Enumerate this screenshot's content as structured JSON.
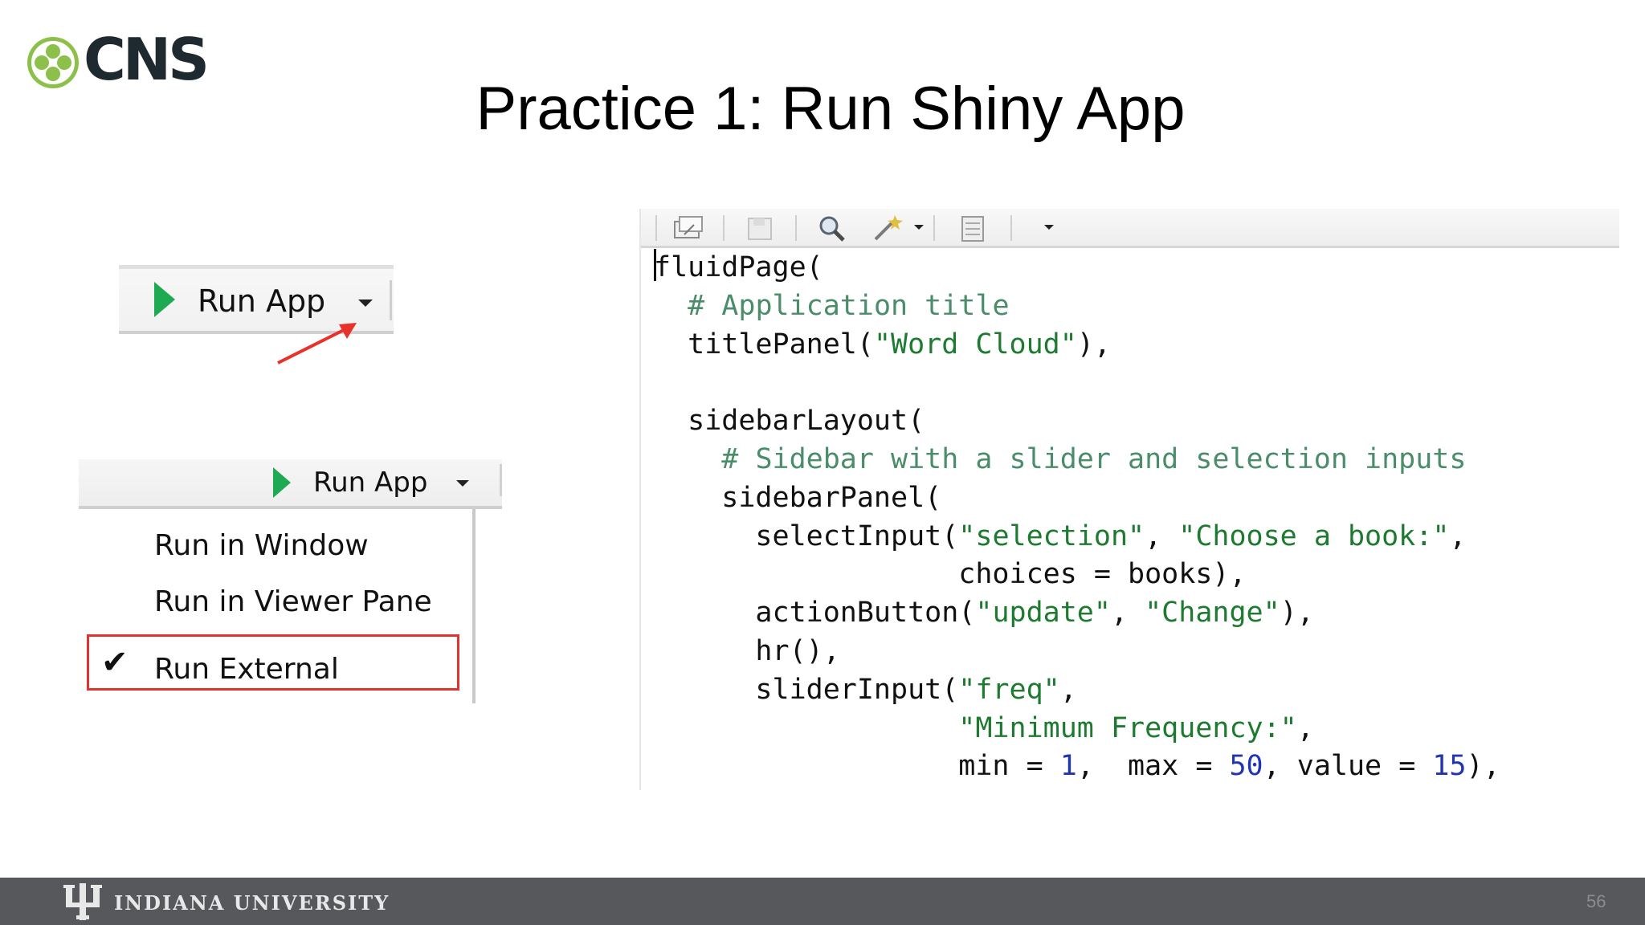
{
  "logo": {
    "text": "CNS",
    "icon": "cns-flower-logo-icon",
    "color": "#8cc04b"
  },
  "slide": {
    "title": "Practice 1: Run Shiny App",
    "page_number": "56"
  },
  "toolbar_top": {
    "run_label": "Run App",
    "play_icon": "play-icon",
    "dropdown_icon": "caret-down-icon"
  },
  "toolbar_menu": {
    "run_label": "Run App"
  },
  "menu": {
    "items": [
      "Run in Window",
      "Run in Viewer Pane",
      "Run External"
    ],
    "checked": "Run External",
    "highlight_color": "#e0322f"
  },
  "editor": {
    "toolbar_icons": [
      "show-in-window-icon",
      "save-icon",
      "search-icon",
      "magic-wand-icon",
      "caret-down-icon",
      "notebook-icon",
      "caret-down-icon"
    ],
    "code_lines": [
      "fluidPage(",
      "  # Application title",
      "  titlePanel(\"Word Cloud\"),",
      "",
      "  sidebarLayout(",
      "    # Sidebar with a slider and selection inputs",
      "    sidebarPanel(",
      "      selectInput(\"selection\", \"Choose a book:\",",
      "                  choices = books),",
      "      actionButton(\"update\", \"Change\"),",
      "      hr(),",
      "      sliderInput(\"freq\",",
      "                  \"Minimum Frequency:\",",
      "                  min = 1,  max = 50, value = 15),"
    ]
  },
  "footer": {
    "university": "INDIANA UNIVERSITY",
    "mark": "iu-trident-icon"
  }
}
